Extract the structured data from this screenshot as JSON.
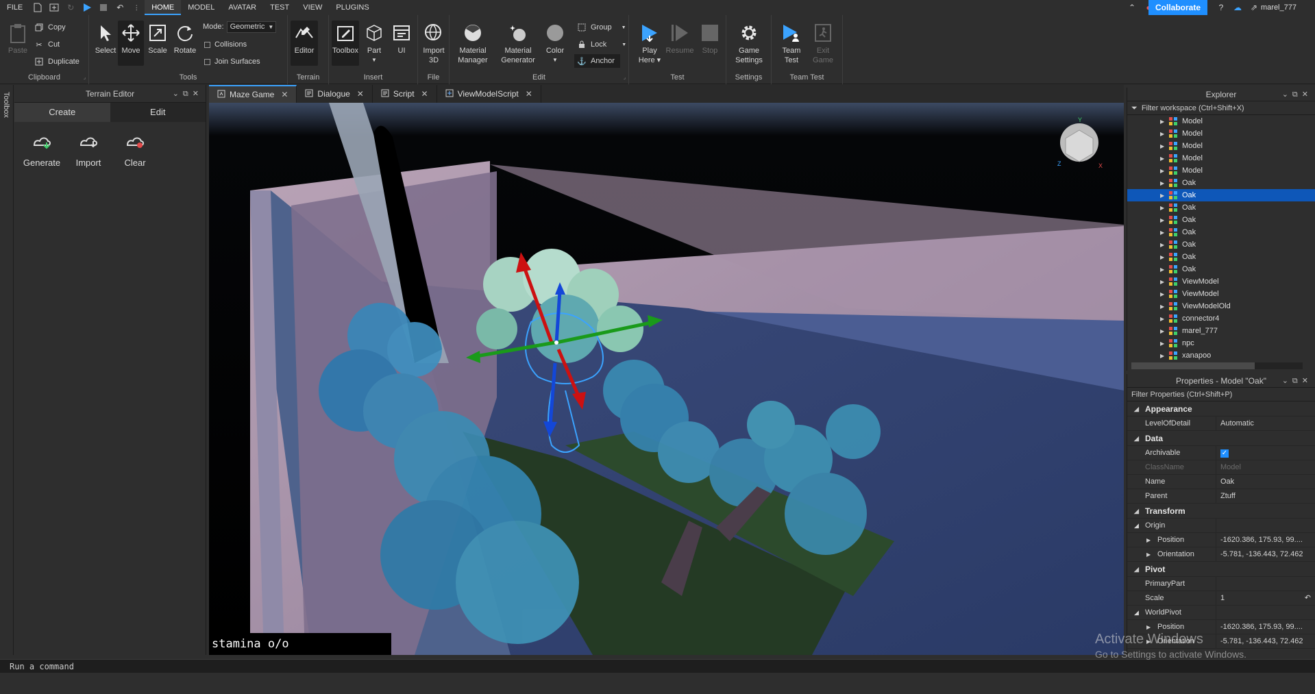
{
  "menubar": {
    "items": [
      "FILE",
      "HOME",
      "MODEL",
      "AVATAR",
      "TEST",
      "VIEW",
      "PLUGINS"
    ],
    "collaborate_label": "Collaborate",
    "username": "marel_777"
  },
  "ribbon": {
    "clipboard": {
      "label": "Clipboard",
      "paste": "Paste",
      "copy": "Copy",
      "cut": "Cut",
      "duplicate": "Duplicate"
    },
    "tools": {
      "label": "Tools",
      "select": "Select",
      "move": "Move",
      "scale": "Scale",
      "rotate": "Rotate",
      "mode_label": "Mode:",
      "mode_value": "Geometric",
      "collisions": "Collisions",
      "join_surfaces": "Join Surfaces"
    },
    "terrain": {
      "label": "Terrain",
      "editor": "Editor"
    },
    "insert": {
      "label": "Insert",
      "toolbox": "Toolbox",
      "part": "Part",
      "ui": "UI"
    },
    "file": {
      "label": "File",
      "import3d_1": "Import",
      "import3d_2": "3D"
    },
    "edit": {
      "label": "Edit",
      "material_manager_1": "Material",
      "material_manager_2": "Manager",
      "material_generator_1": "Material",
      "material_generator_2": "Generator",
      "color": "Color",
      "group": "Group",
      "lock": "Lock",
      "anchor": "Anchor"
    },
    "test": {
      "label": "Test",
      "play_1": "Play",
      "play_2": "Here",
      "resume": "Resume",
      "stop": "Stop"
    },
    "settings": {
      "label": "Settings",
      "game_settings_1": "Game",
      "game_settings_2": "Settings"
    },
    "team_test": {
      "label": "Team Test",
      "team_test_1": "Team",
      "team_test_2": "Test",
      "exit_game_1": "Exit",
      "exit_game_2": "Game"
    }
  },
  "toolbox_strip": "Toolbox",
  "terrain_editor": {
    "title": "Terrain Editor",
    "tabs": [
      "Create",
      "Edit"
    ],
    "tools": [
      "Generate",
      "Import",
      "Clear"
    ]
  },
  "doc_tabs": [
    "Maze Game",
    "Dialogue",
    "Script",
    "ViewModelScript"
  ],
  "viewport": {
    "stamina": "stamina o/o"
  },
  "explorer": {
    "title": "Explorer",
    "filter": "Filter workspace (Ctrl+Shift+X)",
    "items": [
      "Model",
      "Model",
      "Model",
      "Model",
      "Model",
      "Oak",
      "Oak",
      "Oak",
      "Oak",
      "Oak",
      "Oak",
      "Oak",
      "Oak",
      "ViewModel",
      "ViewModel",
      "ViewModelOld",
      "connector4",
      "marel_777",
      "npc",
      "xanapoo"
    ],
    "selected_index": 6
  },
  "properties": {
    "title": "Properties - Model \"Oak\"",
    "filter": "Filter Properties (Ctrl+Shift+P)",
    "appearance": "Appearance",
    "level_of_detail": {
      "name": "LevelOfDetail",
      "value": "Automatic"
    },
    "data": "Data",
    "archivable": {
      "name": "Archivable"
    },
    "classname": {
      "name": "ClassName",
      "value": "Model"
    },
    "name": {
      "name": "Name",
      "value": "Oak"
    },
    "parent": {
      "name": "Parent",
      "value": "Ztuff"
    },
    "transform": "Transform",
    "origin": "Origin",
    "position": {
      "name": "Position",
      "value": "-1620.386, 175.93, 99...."
    },
    "orientation": {
      "name": "Orientation",
      "value": "-5.781, -136.443, 72.462"
    },
    "pivot": "Pivot",
    "primary_part": {
      "name": "PrimaryPart",
      "value": ""
    },
    "scale": {
      "name": "Scale",
      "value": "1"
    },
    "world_pivot": "WorldPivot",
    "wp_position": {
      "name": "Position",
      "value": "-1620.386, 175.93, 99...."
    },
    "wp_orientation": {
      "name": "Orientation",
      "value": "-5.781, -136.443, 72.462"
    }
  },
  "command_bar": {
    "placeholder": "Run a command"
  },
  "watermark": {
    "line1": "Activate Windows",
    "line2": "Go to Settings to activate Windows."
  },
  "colors": {
    "accent": "#3ba3ff",
    "selection": "#0e57b8",
    "collaborate": "#1f8fff"
  }
}
